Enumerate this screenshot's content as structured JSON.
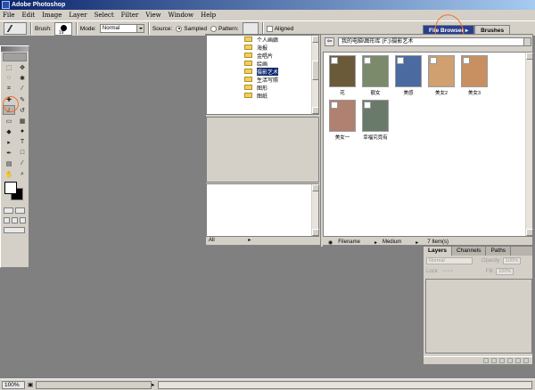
{
  "titlebar": {
    "title": "Adobe Photoshop"
  },
  "menu": [
    "File",
    "Edit",
    "Image",
    "Layer",
    "Select",
    "Filter",
    "View",
    "Window",
    "Help"
  ],
  "options": {
    "brush_label": "Brush:",
    "brush_size": "19",
    "mode_label": "Mode:",
    "mode_value": "Normal",
    "source_label": "Source:",
    "sampled": "Sampled",
    "pattern": "Pattern:",
    "aligned": "Aligned"
  },
  "palette_well": {
    "file_browser": "File Browser",
    "brushes": "Brushes"
  },
  "file_browser": {
    "tree": [
      {
        "label": "个人画廊",
        "selected": false
      },
      {
        "label": "海报",
        "selected": false
      },
      {
        "label": "金唱片",
        "selected": false
      },
      {
        "label": "绘画",
        "selected": false
      },
      {
        "label": "摄影艺术",
        "selected": true
      },
      {
        "label": "生活写照",
        "selected": false
      },
      {
        "label": "图形",
        "selected": false
      },
      {
        "label": "图纸",
        "selected": false
      }
    ],
    "left_footer": "All",
    "path": "我的电脑\\图形库 (F:)\\摄影艺术",
    "thumbnails": [
      {
        "label": "花",
        "color": "#6a5a3a"
      },
      {
        "label": "靓女",
        "color": "#7a8a6a"
      },
      {
        "label": "美感",
        "color": "#4a6aa0"
      },
      {
        "label": "美女2",
        "color": "#d0a070"
      },
      {
        "label": "美女3",
        "color": "#c89060"
      },
      {
        "label": "美女一",
        "color": "#b08070"
      },
      {
        "label": "幸福究竟有",
        "color": "#6a7a6a"
      }
    ],
    "sort": "Filename",
    "size": "Medium",
    "count": "7 Item(s)"
  },
  "layers_panel": {
    "tabs": [
      "Layers",
      "Channels",
      "Paths"
    ],
    "mode": "Normal",
    "opacity_label": "Opacity:",
    "opacity": "100%",
    "lock_label": "Lock:",
    "fill_label": "Fill:",
    "fill": "100%"
  },
  "statusbar": {
    "zoom": "100%"
  }
}
